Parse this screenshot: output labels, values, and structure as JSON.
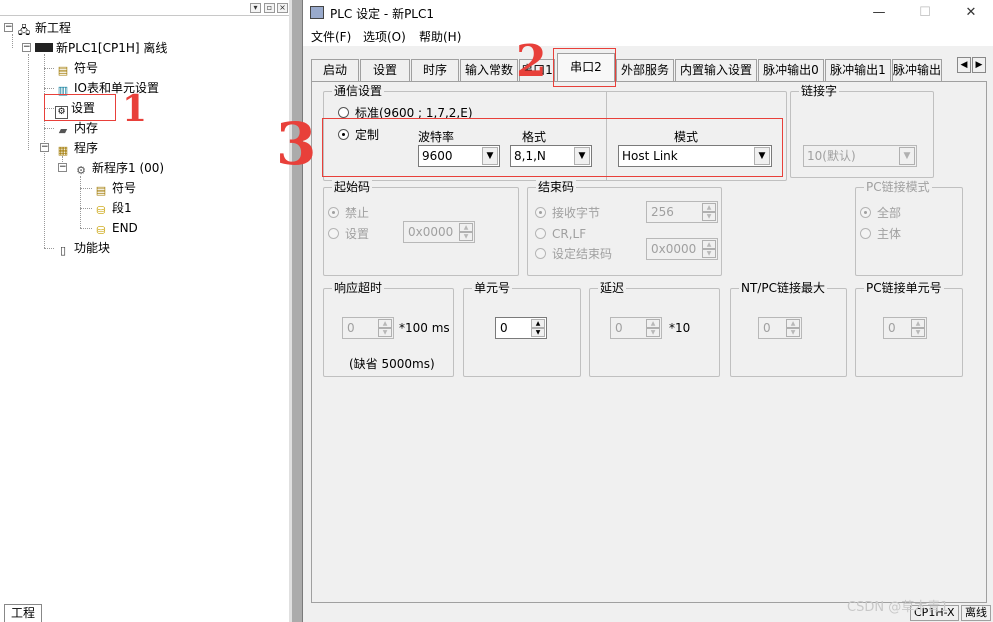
{
  "tree": {
    "root": "新工程",
    "plc": "新PLC1[CP1H] 离线",
    "items": {
      "symbols": "符号",
      "io_table": "IO表和单元设置",
      "settings": "设置",
      "memory": "内存",
      "programs": "程序",
      "program1": "新程序1 (00)",
      "program_symbols": "符号",
      "section1": "段1",
      "end": "END",
      "function_blocks": "功能块"
    },
    "bottom_tab": "工程"
  },
  "dialog": {
    "title": "PLC 设定 - 新PLC1",
    "window_buttons": {
      "minimize": "—",
      "maximize": "☐",
      "close": "✕"
    },
    "menu": [
      "文件(F)",
      "选项(O)",
      "帮助(H)"
    ],
    "tabs": [
      "启动",
      "设置",
      "时序",
      "输入常数",
      "串口1",
      "串口2",
      "外部服务",
      "内置输入设置",
      "脉冲输出0",
      "脉冲输出1",
      "脉冲输出"
    ],
    "active_tab": "串口2",
    "tab_scroll": {
      "left": "◀",
      "right": "▶"
    },
    "comm": {
      "title": "通信设置",
      "standard_label": "标准(9600 ; 1,7,2,E)",
      "custom_label": "定制",
      "baud_label": "波特率",
      "baud_value": "9600",
      "format_label": "格式",
      "format_value": "8,1,N",
      "mode_label": "模式",
      "mode_value": "Host Link"
    },
    "link_word": {
      "title": "链接字",
      "value": "10(默认)"
    },
    "start_code": {
      "title": "起始码",
      "disable": "禁止",
      "set": "设置",
      "value": "0x0000"
    },
    "end_code": {
      "title": "结束码",
      "receive_bytes": "接收字节",
      "receive_value": "256",
      "crlf": "CR,LF",
      "set_end": "设定结束码",
      "end_value": "0x0000"
    },
    "pc_link_mode": {
      "title": "PC链接模式",
      "all": "全部",
      "master": "主体"
    },
    "response_timeout": {
      "title": "响应超时",
      "value": "0",
      "unit": "*100 ms",
      "default_note": "(缺省 5000ms)"
    },
    "unit_number": {
      "title": "单元号",
      "value": "0"
    },
    "delay": {
      "title": "延迟",
      "value": "0",
      "unit": "*10"
    },
    "nt_pc_link_max": {
      "title": "NT/PC链接最大",
      "value": "0"
    },
    "pc_link_unit": {
      "title": "PC链接单元号",
      "value": "0"
    },
    "status": {
      "model": "CP1H-X",
      "mode": "离线"
    }
  },
  "annotations": {
    "one": "1",
    "two": "2",
    "three": "3"
  },
  "watermark": "CSDN @草木青1",
  "colors": {
    "annotation": "#e8403a",
    "dialog_bg": "#f0f0f0"
  }
}
